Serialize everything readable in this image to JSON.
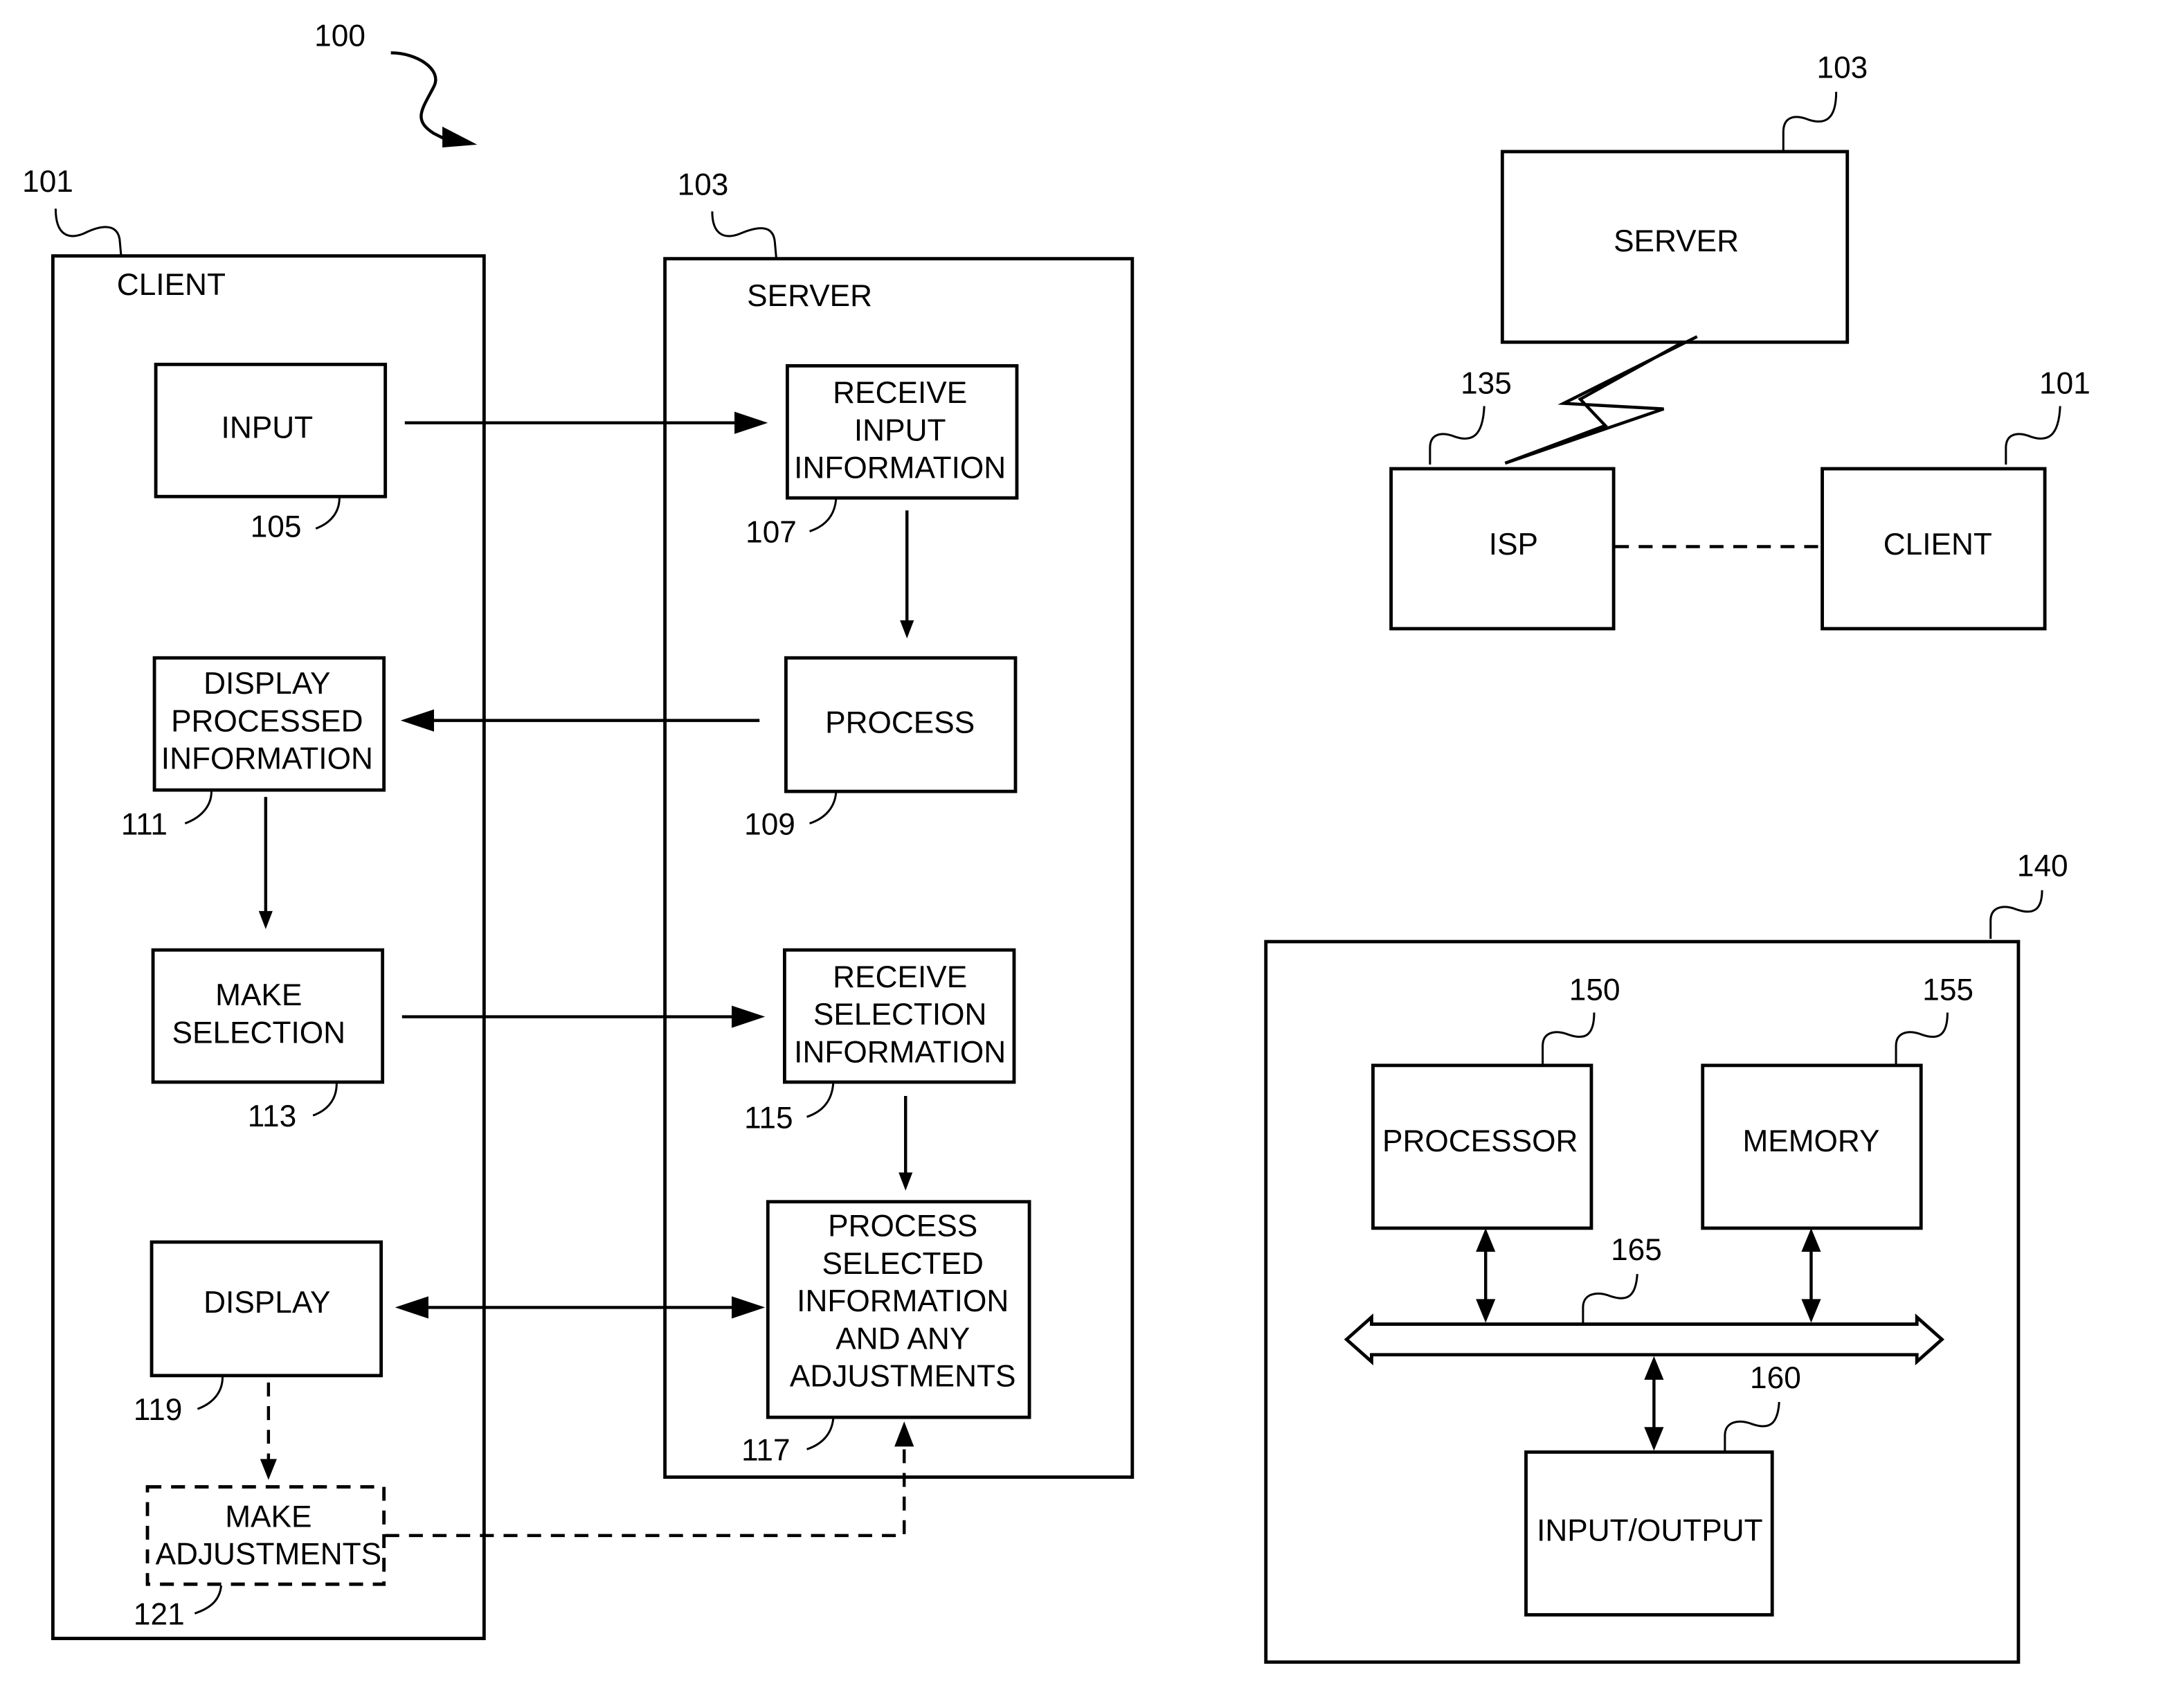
{
  "figure": {
    "ref": "100",
    "client_panel": {
      "ref": "101",
      "title": "CLIENT",
      "blocks": [
        {
          "id": "input",
          "ref": "105",
          "lines": [
            "INPUT"
          ]
        },
        {
          "id": "display-processed",
          "ref": "111",
          "lines": [
            "DISPLAY",
            "PROCESSED",
            "INFORMATION"
          ]
        },
        {
          "id": "make-selection",
          "ref": "113",
          "lines": [
            "MAKE",
            "SELECTION"
          ]
        },
        {
          "id": "display",
          "ref": "119",
          "lines": [
            "DISPLAY"
          ]
        },
        {
          "id": "make-adjustments",
          "ref": "121",
          "lines": [
            "MAKE",
            "ADJUSTMENTS"
          ],
          "style": "dashed"
        }
      ]
    },
    "server_panel": {
      "ref": "103",
      "title": "SERVER",
      "blocks": [
        {
          "id": "receive-input",
          "ref": "107",
          "lines": [
            "RECEIVE",
            "INPUT",
            "INFORMATION"
          ]
        },
        {
          "id": "process",
          "ref": "109",
          "lines": [
            "PROCESS"
          ]
        },
        {
          "id": "receive-selection",
          "ref": "115",
          "lines": [
            "RECEIVE",
            "SELECTION",
            "INFORMATION"
          ]
        },
        {
          "id": "process-selected",
          "ref": "117",
          "lines": [
            "PROCESS",
            "SELECTED",
            "INFORMATION",
            "AND ANY",
            "ADJUSTMENTS"
          ]
        }
      ]
    },
    "network": {
      "server": {
        "ref": "103",
        "label": "SERVER"
      },
      "isp": {
        "ref": "135",
        "label": "ISP"
      },
      "client": {
        "ref": "101",
        "label": "CLIENT"
      }
    },
    "computer": {
      "ref": "140",
      "processor": {
        "ref": "150",
        "label": "PROCESSOR"
      },
      "memory": {
        "ref": "155",
        "label": "MEMORY"
      },
      "bus": {
        "ref": "165"
      },
      "io": {
        "ref": "160",
        "label": "INPUT/OUTPUT"
      }
    }
  }
}
